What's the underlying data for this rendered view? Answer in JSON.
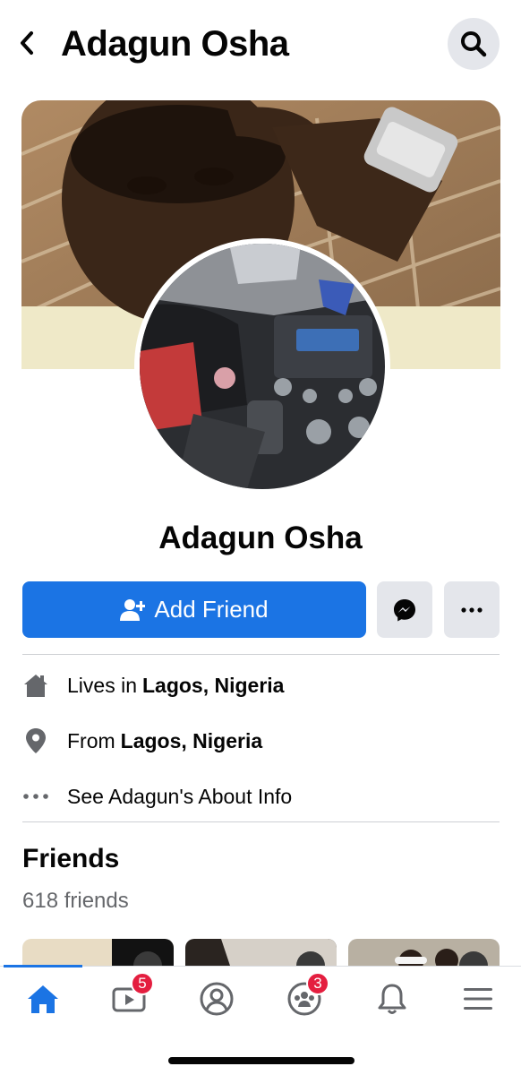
{
  "header": {
    "title": "Adagun Osha"
  },
  "profile": {
    "name": "Adagun Osha",
    "add_friend_label": "Add Friend"
  },
  "intro": {
    "lives_prefix": "Lives in",
    "lives_place": "Lagos, Nigeria",
    "from_prefix": "From",
    "from_place": "Lagos, Nigeria",
    "about_label": "See Adagun's About Info"
  },
  "friends": {
    "title": "Friends",
    "count": "618 friends"
  },
  "tabbar": {
    "watch_badge": "5",
    "groups_badge": "3"
  },
  "colors": {
    "accent": "#1b74e4",
    "badge": "#e41e3f",
    "button_gray": "#e4e6eb"
  },
  "icons": [
    "back-icon",
    "search-icon",
    "add-person-icon",
    "messenger-icon",
    "more-icon",
    "home-icon",
    "location-pin-icon",
    "ellipsis-icon",
    "video-icon",
    "profile-icon",
    "groups-icon",
    "bell-icon",
    "menu-icon"
  ]
}
